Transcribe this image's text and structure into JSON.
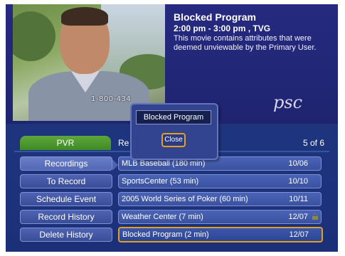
{
  "program_info": {
    "title": "Blocked Program",
    "time": "2:00 pm  - 3:00 pm , TVG",
    "description": "This movie contains attributes that were deemed unviewable by the Primary User."
  },
  "video": {
    "overlay_text": "1-800-434"
  },
  "logo": {
    "text": "psc"
  },
  "pvr": {
    "tab_label": "PVR",
    "list_header": "Re",
    "count": "5 of 6",
    "menu": [
      {
        "label": "Recordings",
        "active": true
      },
      {
        "label": "To Record"
      },
      {
        "label": "Schedule Event"
      },
      {
        "label": "Record History"
      },
      {
        "label": "Delete History"
      }
    ],
    "recordings": [
      {
        "name": "MLB Baseball (180 min)",
        "date": "10/06"
      },
      {
        "name": "SportsCenter (53 min)",
        "date": "10/10"
      },
      {
        "name": "2005 World Series of Poker (60 min)",
        "date": "10/11"
      },
      {
        "name": "Weather Center (7 min)",
        "date": "12/07",
        "locked": true
      },
      {
        "name": "Blocked Program (2 min)",
        "date": "12/07",
        "selected": true
      }
    ]
  },
  "popup": {
    "title": "Blocked Program",
    "close_label": "Close"
  },
  "colors": {
    "accent_highlight": "#e0a020",
    "pvr_tab": "#4e9a31",
    "panel_blue": "#1d2b6e"
  }
}
